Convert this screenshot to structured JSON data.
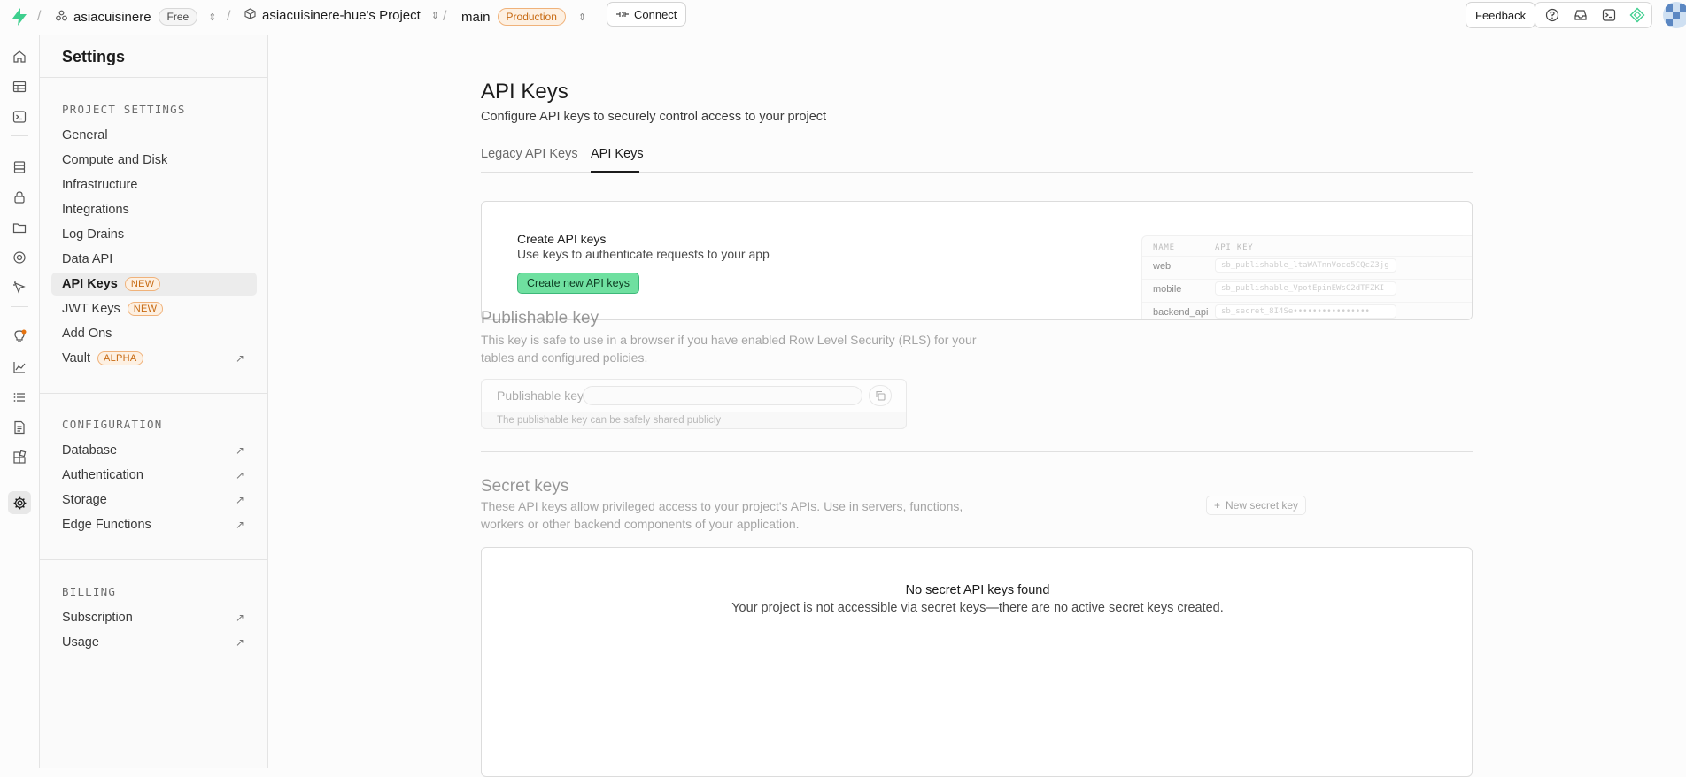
{
  "topbar": {
    "org_name": "asiacuisinere",
    "plan_badge": "Free",
    "project_name": "asiacuisinere-hue's Project",
    "branch": "main",
    "env_badge": "Production",
    "connect_label": "Connect",
    "feedback_label": "Feedback",
    "accent_color": "#3ecf8e"
  },
  "sidebar": {
    "title": "Settings",
    "project_settings": {
      "heading": "PROJECT SETTINGS",
      "items": [
        {
          "label": "General"
        },
        {
          "label": "Compute and Disk"
        },
        {
          "label": "Infrastructure"
        },
        {
          "label": "Integrations"
        },
        {
          "label": "Log Drains"
        },
        {
          "label": "Data API"
        },
        {
          "label": "API Keys",
          "tag": "NEW"
        },
        {
          "label": "JWT Keys",
          "tag": "NEW"
        },
        {
          "label": "Add Ons"
        },
        {
          "label": "Vault",
          "tag": "ALPHA"
        }
      ]
    },
    "configuration": {
      "heading": "CONFIGURATION",
      "items": [
        {
          "label": "Database"
        },
        {
          "label": "Authentication"
        },
        {
          "label": "Storage"
        },
        {
          "label": "Edge Functions"
        }
      ]
    },
    "billing": {
      "heading": "BILLING",
      "items": [
        {
          "label": "Subscription"
        },
        {
          "label": "Usage"
        }
      ]
    }
  },
  "main": {
    "title": "API Keys",
    "subtitle": "Configure API keys to securely control access to your project",
    "tabs": [
      {
        "label": "Legacy API Keys"
      },
      {
        "label": "API Keys"
      }
    ],
    "create_card": {
      "title": "Create API keys",
      "subtitle": "Use keys to authenticate requests to your app",
      "button": "Create new API keys",
      "preview": {
        "col_name": "NAME",
        "col_key": "API KEY",
        "rows": [
          {
            "name": "web",
            "key": "sb_publishable_ltaWATnnVoco5CQcZ3jg"
          },
          {
            "name": "mobile",
            "key": "sb_publishable_VpotEpinEWsC2dTFZKI"
          },
          {
            "name": "backend_api",
            "key": "sb_secret_8I4Se••••••••••••••••"
          }
        ]
      }
    },
    "publishable": {
      "title": "Publishable key",
      "description": "This key is safe to use in a browser if you have enabled Row Level Security (RLS) for your tables and configured policies.",
      "field_label": "Publishable key",
      "field_value": "",
      "footer": "The publishable key can be safely shared publicly"
    },
    "secret": {
      "title": "Secret keys",
      "description": "These API keys allow privileged access to your project's APIs. Use in servers, functions, workers or other backend components of your application.",
      "new_button": "New secret key",
      "empty_title": "No secret API keys found",
      "empty_subtitle": "Your project is not accessible via secret keys—there are no active secret keys created."
    }
  }
}
